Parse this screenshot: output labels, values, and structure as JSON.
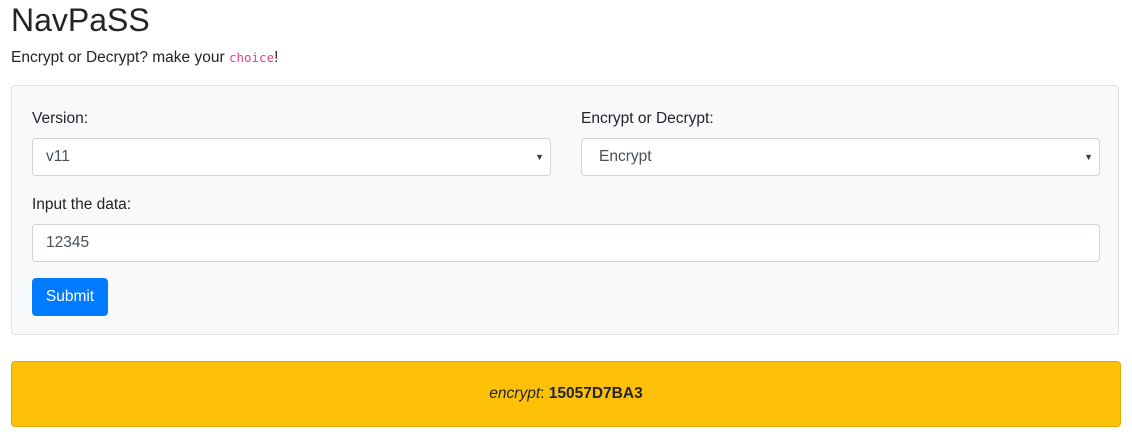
{
  "app": {
    "title": "NavPaSS",
    "subtitle_prefix": "Encrypt or Decrypt? make your ",
    "subtitle_code": "choice",
    "subtitle_suffix": "!"
  },
  "form": {
    "version_label": "Version:",
    "version_value": "v11",
    "mode_label": "Encrypt or Decrypt:",
    "mode_value": "Encrypt",
    "data_label": "Input the data:",
    "data_value": "12345",
    "submit_label": "Submit"
  },
  "result": {
    "mode": "encrypt",
    "separator": ": ",
    "value": "15057D7BA3"
  },
  "colors": {
    "primary": "#007bff",
    "warning": "#ffc107",
    "code": "#e83e8c"
  }
}
